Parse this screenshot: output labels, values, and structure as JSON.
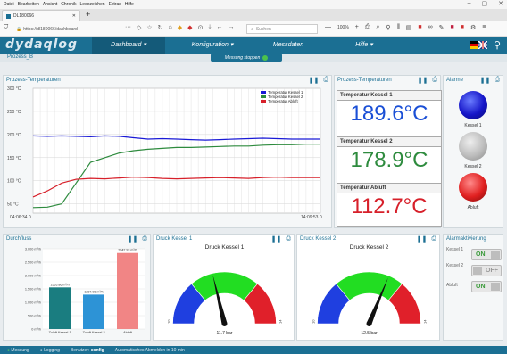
{
  "browser": {
    "menu": [
      "Datei",
      "Bearbeiten",
      "Ansicht",
      "Chronik",
      "Lesezeichen",
      "Extras",
      "Hilfe"
    ],
    "tab_title": "DL180066",
    "url": "https://dl180066/dashboard",
    "search_placeholder": "Suchen",
    "zoom": "100%"
  },
  "app": {
    "logo": "dydaqlog",
    "menu": {
      "dashboard": "Dashboard ▾",
      "konfiguration": "Konfiguration ▾",
      "messdaten": "Messdaten",
      "hilfe": "Hilfe ▾"
    },
    "breadcrumb": "Prozess_B",
    "stop_button": "Messung stoppen"
  },
  "panels": {
    "temp_chart": "Prozess-Temperaturen",
    "temp_values": "Prozess-Temperaturen",
    "alarme": "Alarme",
    "durchfluss": "Durchfluss",
    "druck1": "Druck Kessel 1",
    "druck2": "Druck Kessel 2",
    "alarmaktivierung": "Alarmaktivierung"
  },
  "temp_values": [
    {
      "label": "Temperatur Kessel 1",
      "value": "189.6°C",
      "color": "#1a4fd6"
    },
    {
      "label": "Temperatur Kessel 2",
      "value": "178.9°C",
      "color": "#2e8b3e"
    },
    {
      "label": "Temperatur Abluft",
      "value": "112.7°C",
      "color": "#d7202a"
    }
  ],
  "alarms": [
    {
      "label": "Kessel 1",
      "color": "blue"
    },
    {
      "label": "Kessel 2",
      "color": "grey"
    },
    {
      "label": "Abluft",
      "color": "red"
    }
  ],
  "alarm_activation": [
    {
      "label": "Kessel 1",
      "state": "ON"
    },
    {
      "label": "Kessel 2",
      "state": "OFF"
    },
    {
      "label": "Abluft",
      "state": "ON"
    }
  ],
  "gauges": [
    {
      "title": "Druck Kessel 1",
      "value": 11.7,
      "value_label": "11.7 bar",
      "min": 10,
      "max": 14,
      "min_label": "10",
      "max_label": "14"
    },
    {
      "title": "Druck Kessel 2",
      "value": 12.5,
      "value_label": "12.5 bar",
      "min": 10,
      "max": 14,
      "min_label": "10",
      "max_label": "14"
    }
  ],
  "status": {
    "messung": "Messung",
    "logging": "Logging",
    "benutzer_label": "Benutzer:",
    "benutzer": "config",
    "auto_logout": "Automatisches Abmelden in 10 min"
  },
  "colors": {
    "primary": "#1b6f93",
    "kessel1": "#1a1ad6",
    "kessel2": "#2e8b3e",
    "abluft": "#d7202a"
  },
  "chart_data": [
    {
      "type": "line",
      "title": "",
      "ylabel": "",
      "ylim": [
        30,
        300
      ],
      "yticks": [
        "50 °C",
        "100 °C",
        "150 °C",
        "200 °C",
        "250 °C",
        "300 °C"
      ],
      "xtick_labels": [
        "04:06:34.0",
        "14:09:53.0"
      ],
      "legend": "top-right",
      "x": [
        0,
        1,
        2,
        3,
        4,
        5,
        6,
        7,
        8,
        9,
        10,
        11,
        12,
        13,
        14,
        15,
        16,
        17,
        18,
        19,
        20
      ],
      "series": [
        {
          "name": "Temperatur Kessel 1",
          "color": "#1a1ad6",
          "values": [
            197,
            196,
            197,
            196,
            195,
            197,
            196,
            193,
            190,
            191,
            190,
            189,
            188,
            189,
            190,
            191,
            192,
            191,
            190,
            190,
            190
          ]
        },
        {
          "name": "Temperatur Kessel 2",
          "color": "#2e8b3e",
          "values": [
            42,
            43,
            50,
            95,
            140,
            150,
            160,
            165,
            168,
            170,
            172,
            172,
            173,
            174,
            175,
            175,
            177,
            178,
            178,
            179,
            179
          ]
        },
        {
          "name": "Temperatur Abluft",
          "color": "#d7202a",
          "values": [
            65,
            78,
            95,
            103,
            105,
            104,
            106,
            108,
            107,
            105,
            104,
            105,
            106,
            107,
            106,
            105,
            107,
            108,
            107,
            107,
            107
          ]
        }
      ]
    },
    {
      "type": "bar",
      "title": "",
      "ylim": [
        0,
        3000
      ],
      "yticks": [
        "0 m³/h",
        "500 m³/h",
        "1.000 m³/h",
        "1.500 m³/h",
        "2.000 m³/h",
        "2.500 m³/h",
        "3.000 m³/h"
      ],
      "categories": [
        "Zuluft Kessel 1",
        "Zuluft Kessel 2",
        "Abluft"
      ],
      "values": [
        1555.86,
        1287.08,
        2842.93
      ],
      "value_labels": [
        "1555.86 m³/h",
        "1287.08 m³/h",
        "2842.93 m³/h"
      ],
      "colors": [
        "#1a7d80",
        "#2d93d6",
        "#f18585"
      ]
    }
  ]
}
